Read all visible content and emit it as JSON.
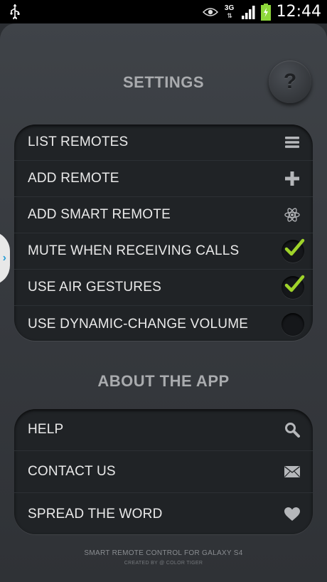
{
  "status_bar": {
    "network": "3G",
    "time": "12:44"
  },
  "settings": {
    "title": "SETTINGS",
    "help_label": "?",
    "items": [
      {
        "label": "LIST REMOTES",
        "icon": "list-icon"
      },
      {
        "label": "ADD REMOTE",
        "icon": "plus-icon"
      },
      {
        "label": "ADD SMART REMOTE",
        "icon": "atom-icon"
      },
      {
        "label": "MUTE WHEN RECEIVING CALLS",
        "checked": true
      },
      {
        "label": "USE AIR GESTURES",
        "checked": true
      },
      {
        "label": "USE DYNAMIC-CHANGE VOLUME",
        "checked": false
      }
    ]
  },
  "about": {
    "title": "ABOUT THE APP",
    "items": [
      {
        "label": "HELP",
        "icon": "search-icon"
      },
      {
        "label": "CONTACT US",
        "icon": "mail-icon"
      },
      {
        "label": "SPREAD THE WORD",
        "icon": "heart-icon"
      }
    ]
  },
  "footer": {
    "line1": "SMART REMOTE CONTROL FOR GALAXY S4",
    "line2": "CREATED BY @ COLOR TIGER"
  },
  "colors": {
    "accent_check": "#9fd32a",
    "side_tab_arrow": "#2a9fd6"
  }
}
